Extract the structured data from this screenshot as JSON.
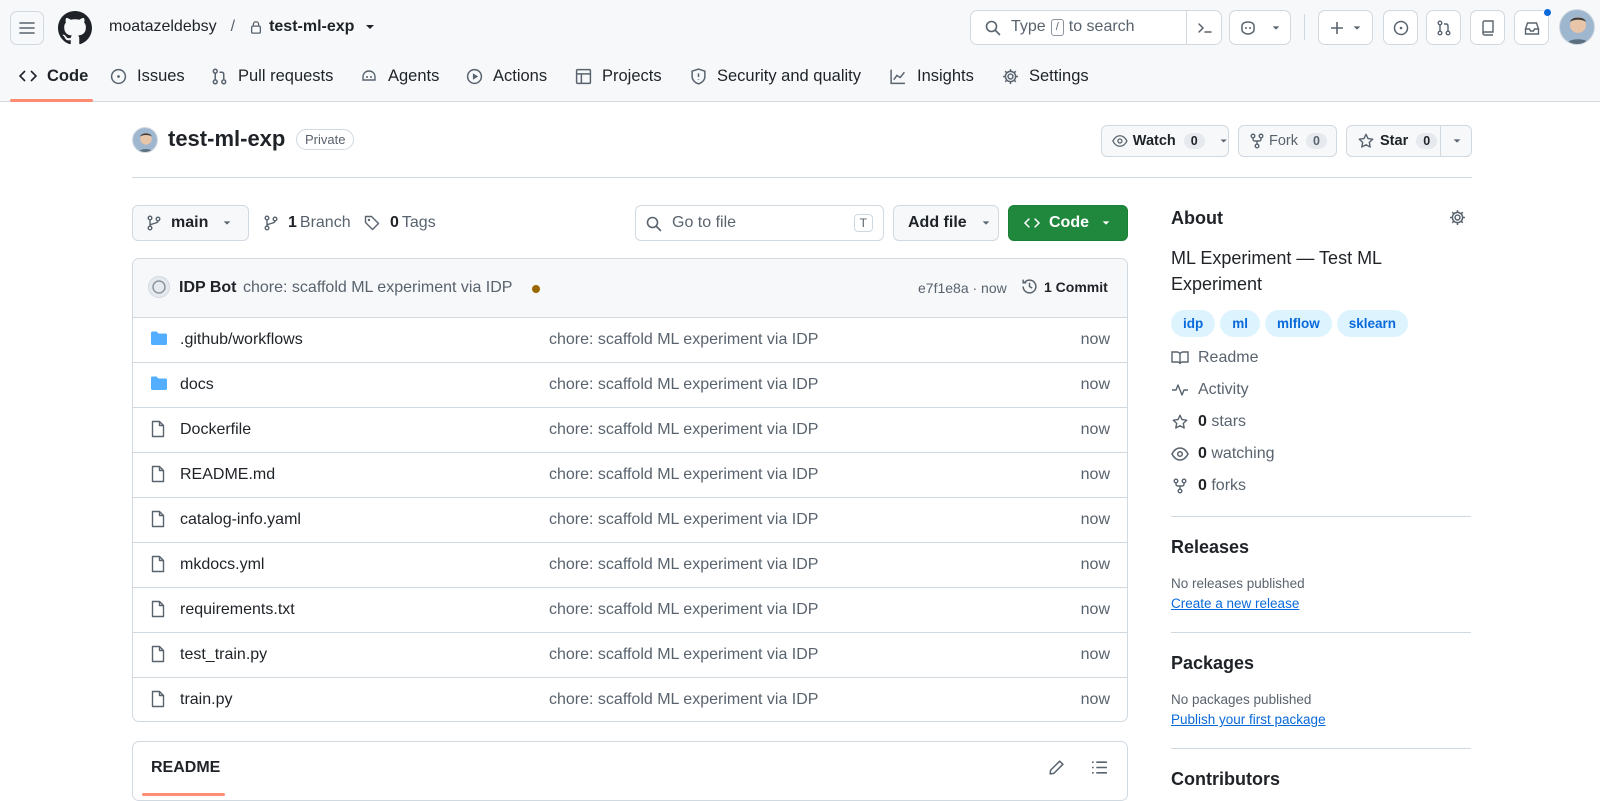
{
  "header": {
    "owner": "moatazeldebsy",
    "separator": "/",
    "repo": "test-ml-exp",
    "search_placeholder_pre": "Type",
    "search_key": "/",
    "search_placeholder_post": "to search"
  },
  "tabs": [
    {
      "label": "Code",
      "icon": "code-icon"
    },
    {
      "label": "Issues",
      "icon": "issue-icon"
    },
    {
      "label": "Pull requests",
      "icon": "pull-request-icon"
    },
    {
      "label": "Agents",
      "icon": "agents-icon"
    },
    {
      "label": "Actions",
      "icon": "play-icon"
    },
    {
      "label": "Projects",
      "icon": "table-icon"
    },
    {
      "label": "Security and quality",
      "icon": "shield-icon"
    },
    {
      "label": "Insights",
      "icon": "graph-icon"
    },
    {
      "label": "Settings",
      "icon": "gear-icon"
    }
  ],
  "repo": {
    "name": "test-ml-exp",
    "visibility": "Private",
    "watch_label": "Watch",
    "watch_count": "0",
    "fork_label": "Fork",
    "fork_count": "0",
    "star_label": "Star",
    "star_count": "0"
  },
  "toolbar": {
    "branch": "main",
    "branch_count": "1",
    "branch_label": "Branch",
    "tag_count": "0",
    "tag_label": "Tags",
    "goto_placeholder": "Go to file",
    "goto_key": "T",
    "add_file": "Add file",
    "code": "Code"
  },
  "commit": {
    "author": "IDP Bot",
    "message": "chore: scaffold ML experiment via IDP",
    "sha_time": "e7f1e8a · now",
    "count_label": "1 Commit"
  },
  "files": [
    {
      "name": ".github/workflows",
      "type": "folder",
      "message": "chore: scaffold ML experiment via IDP",
      "time": "now"
    },
    {
      "name": "docs",
      "type": "folder",
      "message": "chore: scaffold ML experiment via IDP",
      "time": "now"
    },
    {
      "name": "Dockerfile",
      "type": "file",
      "message": "chore: scaffold ML experiment via IDP",
      "time": "now"
    },
    {
      "name": "README.md",
      "type": "file",
      "message": "chore: scaffold ML experiment via IDP",
      "time": "now"
    },
    {
      "name": "catalog-info.yaml",
      "type": "file",
      "message": "chore: scaffold ML experiment via IDP",
      "time": "now"
    },
    {
      "name": "mkdocs.yml",
      "type": "file",
      "message": "chore: scaffold ML experiment via IDP",
      "time": "now"
    },
    {
      "name": "requirements.txt",
      "type": "file",
      "message": "chore: scaffold ML experiment via IDP",
      "time": "now"
    },
    {
      "name": "test_train.py",
      "type": "file",
      "message": "chore: scaffold ML experiment via IDP",
      "time": "now"
    },
    {
      "name": "train.py",
      "type": "file",
      "message": "chore: scaffold ML experiment via IDP",
      "time": "now"
    }
  ],
  "readme": {
    "title": "README"
  },
  "about": {
    "title": "About",
    "description": "ML Experiment — Test ML Experiment",
    "topics": [
      "idp",
      "ml",
      "mlflow",
      "sklearn"
    ],
    "readme": "Readme",
    "activity": "Activity",
    "stars_count": "0",
    "stars_label": "stars",
    "watching_count": "0",
    "watching_label": "watching",
    "forks_count": "0",
    "forks_label": "forks"
  },
  "releases": {
    "title": "Releases",
    "empty": "No releases published",
    "link": "Create a new release"
  },
  "packages": {
    "title": "Packages",
    "empty": "No packages published",
    "link": "Publish your first package"
  },
  "contributors": {
    "title": "Contributors"
  },
  "colors": {
    "accent_tab": "#fd8c73",
    "primary": "#1f883d",
    "link": "#0969da",
    "commit_dot": "#9a6700",
    "folder": "#54aeff"
  }
}
